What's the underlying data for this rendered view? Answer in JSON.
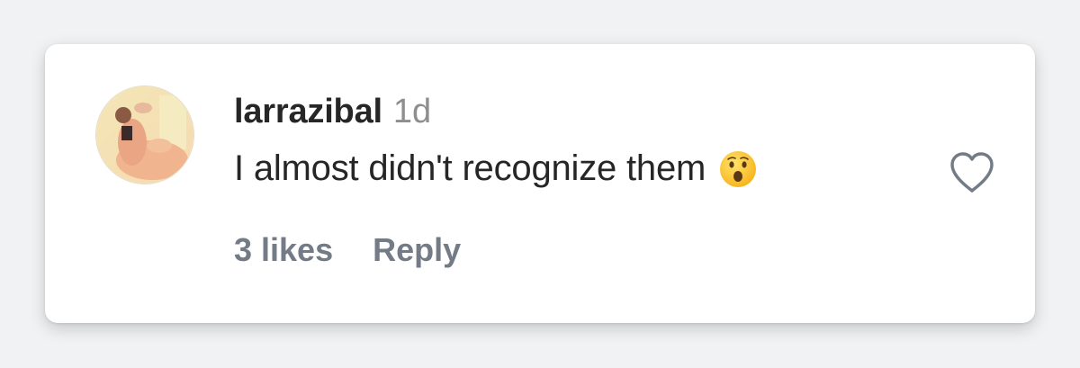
{
  "comment": {
    "username": "larrazibal",
    "timestamp": "1d",
    "text": "I almost didn't recognize them",
    "emoji": "hushed-face-emoji",
    "likes_label": "3 likes",
    "reply_label": "Reply"
  },
  "icons": {
    "like": "heart-outline-icon",
    "avatar": "user-avatar"
  },
  "colors": {
    "page_background": "#f1f2f4",
    "card_background": "#ffffff",
    "primary_text": "#262626",
    "secondary_text": "#8e8e8e",
    "action_text": "#737b86"
  }
}
